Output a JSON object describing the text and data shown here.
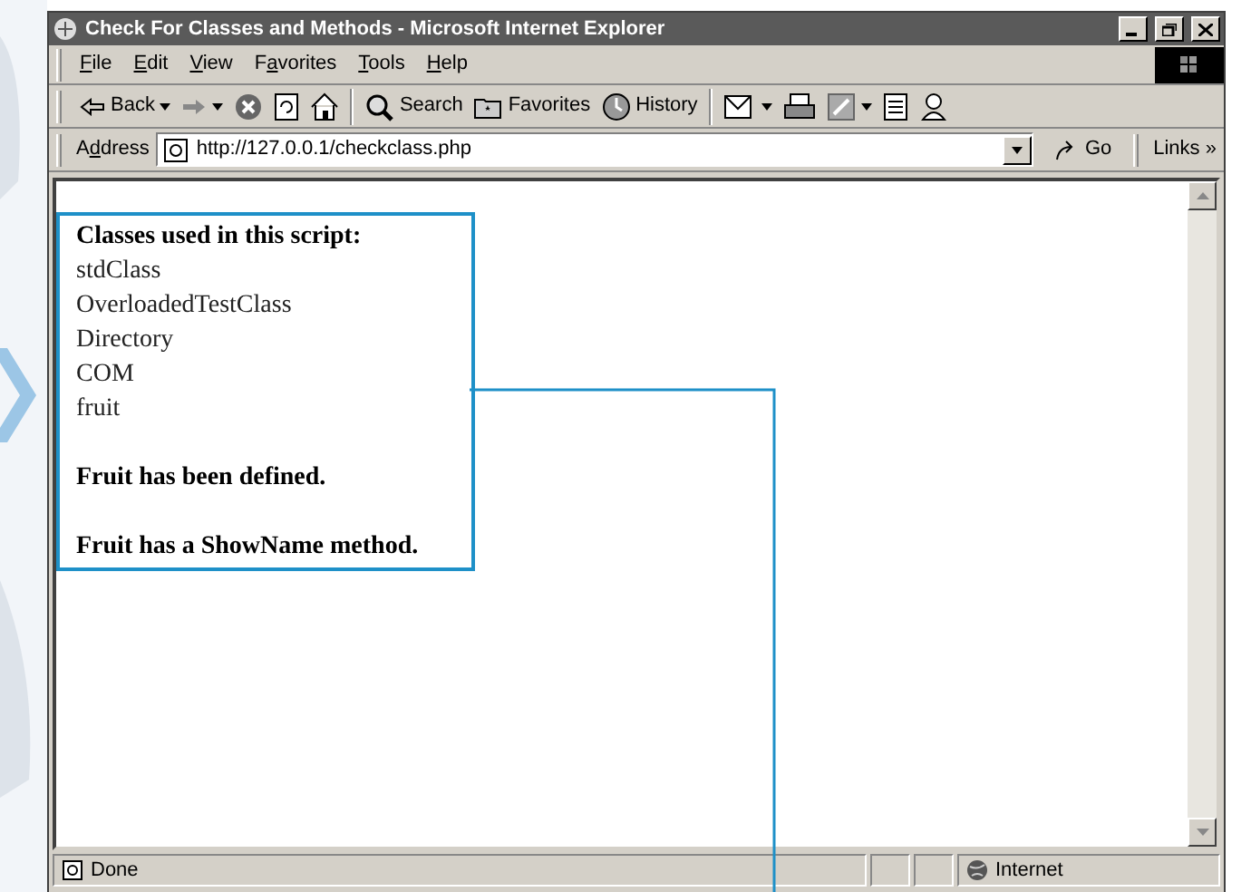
{
  "window": {
    "title": "Check For Classes and Methods - Microsoft Internet Explorer"
  },
  "menu": [
    {
      "label": "File"
    },
    {
      "label": "Edit"
    },
    {
      "label": "View"
    },
    {
      "label": "Favorites"
    },
    {
      "label": "Tools"
    },
    {
      "label": "Help"
    }
  ],
  "toolbar": [
    {
      "label": "Back",
      "dropdown": true
    },
    {
      "dropdown": true
    },
    {
      "dropdown": false
    },
    {
      "dropdown": false
    },
    {
      "dropdown": false
    },
    {
      "label": "Search",
      "dropdown": false
    },
    {
      "label": "Favorites",
      "dropdown": false
    },
    {
      "label": "History",
      "dropdown": false
    },
    {
      "dropdown": true
    },
    {
      "dropdown": false
    },
    {
      "dropdown": true
    },
    {
      "dropdown": false
    },
    {
      "dropdown": false
    }
  ],
  "address_bar": {
    "label": "Address",
    "url": "http://127.0.0.1/checkclass.php",
    "go": "Go",
    "links": "Links",
    "more": "»"
  },
  "page": {
    "heading": "Classes used in this script:",
    "classes": [
      "stdClass",
      "OverloadedTestClass",
      "Directory",
      "COM",
      "fruit"
    ],
    "messages": [
      "Fruit has been defined.",
      "Fruit has a ShowName method."
    ]
  },
  "status_bar": {
    "text": "Done",
    "zone": "Internet"
  }
}
